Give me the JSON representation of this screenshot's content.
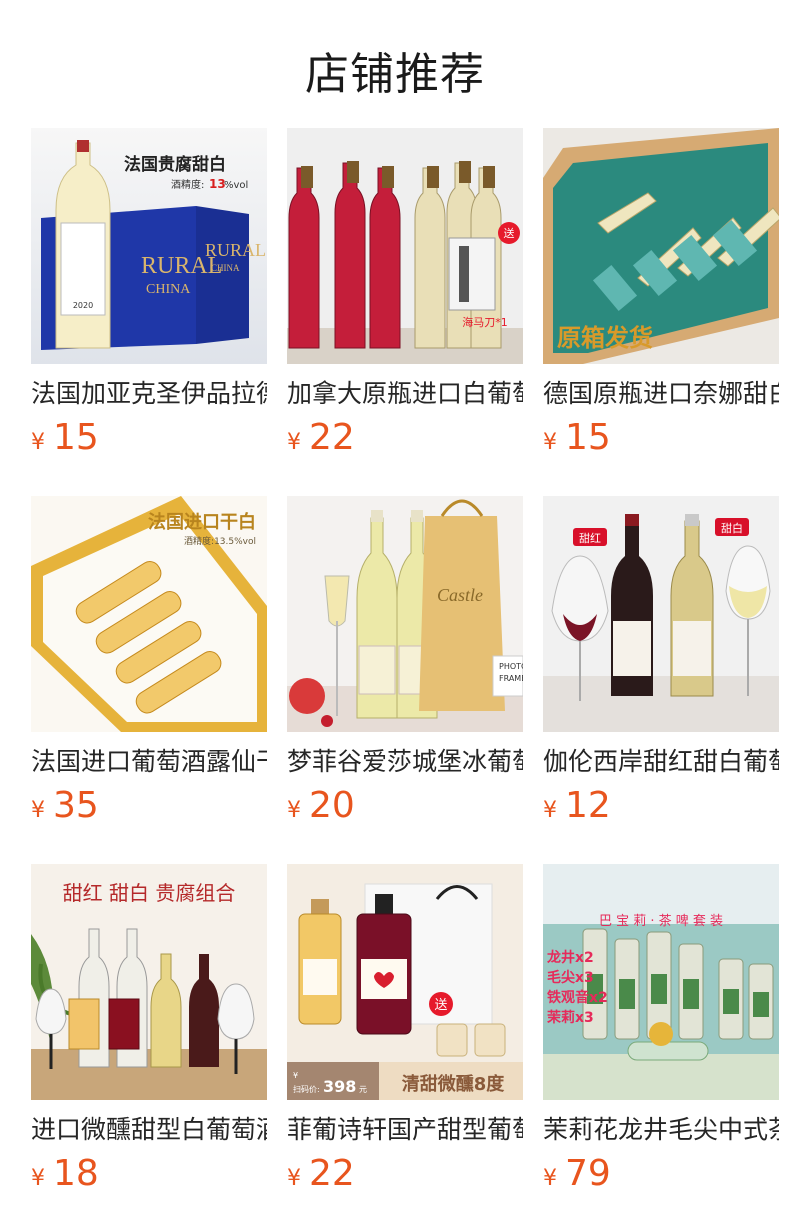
{
  "page_title": "店铺推荐",
  "currency_symbol": "¥",
  "products": [
    {
      "name": "法国加亚克圣伊品拉德贵腐甜白",
      "price": "15",
      "image_texts": [
        "法国贵腐甜白",
        "酒精度:",
        "13",
        "%vol",
        "RURAL",
        "CHINA",
        "2020"
      ]
    },
    {
      "name": "加拿大原瓶进口白葡萄酒冰酒",
      "price": "22",
      "image_texts": [
        "送",
        "海马刀*1"
      ]
    },
    {
      "name": "德国原瓶进口奈娜甜白葡萄酒",
      "price": "15",
      "image_texts": [
        "原箱发货"
      ]
    },
    {
      "name": "法国进口葡萄酒露仙干白",
      "price": "35",
      "image_texts": [
        "法国进口干白",
        "酒精度:13.5%vol"
      ]
    },
    {
      "name": "梦菲谷爱莎城堡冰葡萄酒",
      "price": "20",
      "image_texts": [
        "Castle",
        "PHOTO",
        "FRAME"
      ]
    },
    {
      "name": "伽伦西岸甜红甜白葡萄酒",
      "price": "12",
      "image_texts": [
        "甜红",
        "甜白"
      ]
    },
    {
      "name": "进口微醺甜型白葡萄酒组合",
      "price": "18",
      "image_texts": [
        "甜红 甜白 贵腐组合"
      ]
    },
    {
      "name": "菲葡诗轩国产甜型葡萄酒",
      "price": "22",
      "image_texts": [
        "送",
        "¥",
        "扫码价:",
        "398",
        "元",
        "清甜微醺8度"
      ]
    },
    {
      "name": "茉莉花龙井毛尖中式茶啤",
      "price": "79",
      "image_texts": [
        "巴 宝 莉 · 茶 啤 套 装",
        "龙井x2",
        "毛尖x3",
        "铁观音x2",
        "茉莉x3"
      ]
    }
  ],
  "colors": {
    "price": "#e8551e",
    "title": "#1a1a1a"
  }
}
